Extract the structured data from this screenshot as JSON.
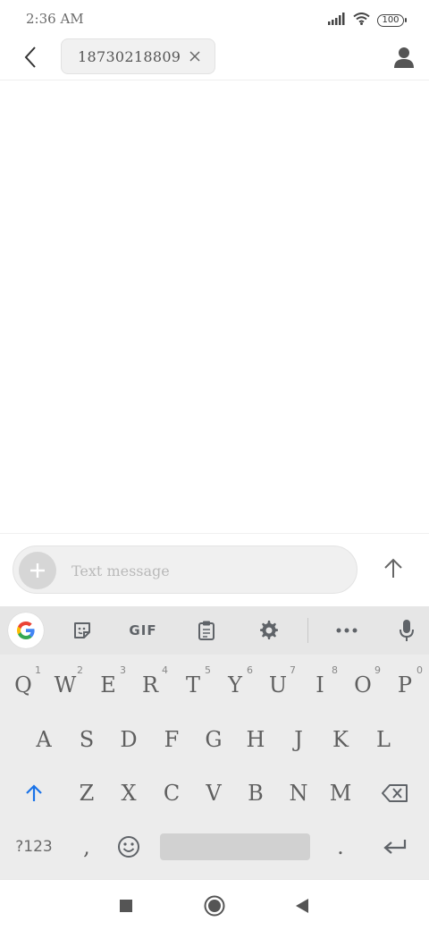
{
  "status_bar": {
    "time": "2:36 AM",
    "battery": "100",
    "icons": [
      "signal-icon",
      "wifi-icon",
      "battery-icon"
    ]
  },
  "header": {
    "recipient_chip": "18730218809",
    "icons": [
      "back-arrow-icon",
      "chip-remove-icon",
      "contact-person-icon"
    ]
  },
  "compose": {
    "placeholder": "Text message",
    "value": "",
    "icons": [
      "plus-icon",
      "send-arrow-icon"
    ]
  },
  "keyboard": {
    "toolbar": {
      "gif_label": "GIF",
      "icons": [
        "google-g-icon",
        "sticker-icon",
        "clipboard-icon",
        "gear-icon",
        "more-dots-icon",
        "mic-icon"
      ]
    },
    "row1": [
      {
        "key": "Q",
        "hint": "1"
      },
      {
        "key": "W",
        "hint": "2"
      },
      {
        "key": "E",
        "hint": "3"
      },
      {
        "key": "R",
        "hint": "4"
      },
      {
        "key": "T",
        "hint": "5"
      },
      {
        "key": "Y",
        "hint": "6"
      },
      {
        "key": "U",
        "hint": "7"
      },
      {
        "key": "I",
        "hint": "8"
      },
      {
        "key": "O",
        "hint": "9"
      },
      {
        "key": "P",
        "hint": "0"
      }
    ],
    "row2": [
      "A",
      "S",
      "D",
      "F",
      "G",
      "H",
      "J",
      "K",
      "L"
    ],
    "row3": [
      "Z",
      "X",
      "C",
      "V",
      "B",
      "N",
      "M"
    ],
    "row4": {
      "symbols": "?123",
      "comma": ",",
      "period": "."
    }
  },
  "navbar": {
    "icons": [
      "recents-square-icon",
      "home-circle-icon",
      "back-triangle-icon"
    ]
  },
  "colors": {
    "keyboard_bg": "#ececec",
    "toolbar_bg": "#e6e6e6",
    "shift_accent": "#1a73e8",
    "key_text": "#5f5f5f"
  }
}
